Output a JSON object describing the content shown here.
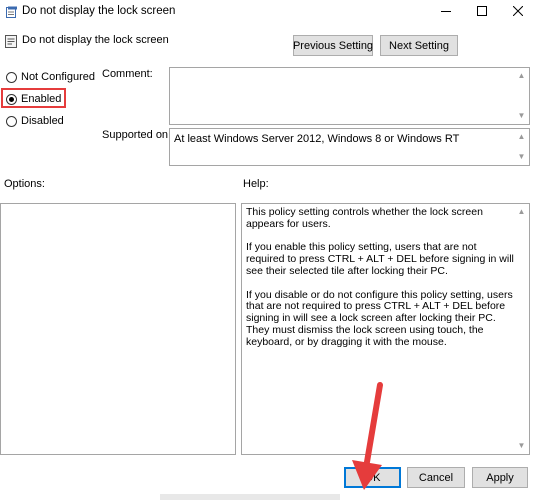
{
  "window": {
    "title": "Do not display the lock screen",
    "title_icon": "policy-document-icon",
    "controls": [
      "minimize-icon",
      "maximize-icon",
      "close-icon"
    ]
  },
  "header": {
    "policy_name": "Do not display the lock screen",
    "policy_icon": "policy-setting-icon",
    "previous_label": "Previous Setting",
    "next_label": "Next Setting"
  },
  "state": {
    "options": [
      {
        "label": "Not Configured",
        "checked": false
      },
      {
        "label": "Enabled",
        "checked": true
      },
      {
        "label": "Disabled",
        "checked": false
      }
    ],
    "highlight_color": "#e53c3c"
  },
  "comment": {
    "label": "Comment:",
    "value": ""
  },
  "supported": {
    "label": "Supported on:",
    "value": "At least Windows Server 2012, Windows 8 or Windows RT"
  },
  "options_panel": {
    "label": "Options:"
  },
  "help": {
    "label": "Help:",
    "paragraphs": [
      "This policy setting controls whether the lock screen appears for users.",
      "If you enable this policy setting, users that are not required to press CTRL + ALT + DEL before signing in will see their selected tile after  locking their PC.",
      "If you disable or do not configure this policy setting, users that are not required to press CTRL + ALT + DEL before signing in will see a lock screen after locking their PC. They must dismiss the lock screen using touch, the keyboard, or by dragging it with the mouse."
    ]
  },
  "footer": {
    "ok_label": "OK",
    "cancel_label": "Cancel",
    "apply_label": "Apply",
    "ok_accent": "#0078d7"
  },
  "annotation": {
    "arrow_icon": "red-arrow-icon",
    "arrow_color": "#e53c3c"
  }
}
